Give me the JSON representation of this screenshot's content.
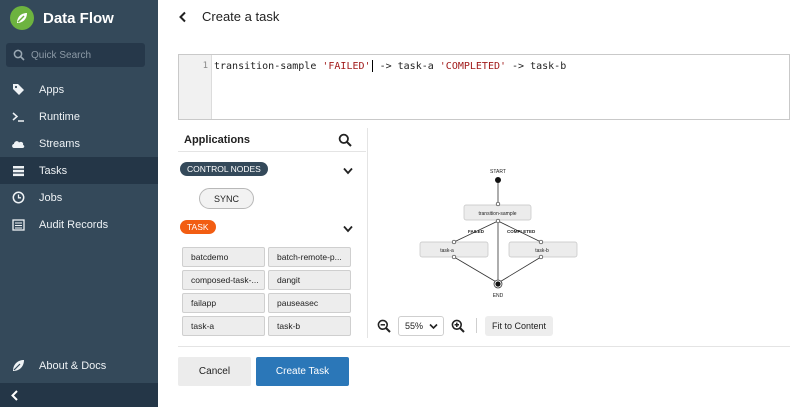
{
  "app": {
    "title": "Data Flow"
  },
  "sidebar": {
    "search_placeholder": "Quick Search",
    "items": [
      {
        "label": "Apps",
        "icon": "tag-icon"
      },
      {
        "label": "Runtime",
        "icon": "terminal-icon"
      },
      {
        "label": "Streams",
        "icon": "cloud-icon"
      },
      {
        "label": "Tasks",
        "icon": "server-icon",
        "active": true
      },
      {
        "label": "Jobs",
        "icon": "clock-icon"
      },
      {
        "label": "Audit Records",
        "icon": "list-icon"
      }
    ],
    "bottom": {
      "label": "About & Docs",
      "icon": "leaf-icon"
    }
  },
  "header": {
    "title": "Create a task"
  },
  "editor": {
    "line_number": "1",
    "code_part1": "transition-sample ",
    "code_str1": "'FAILED'",
    "code_part2": " -> task-a ",
    "code_str2": "'COMPLETED'",
    "code_part3": " -> task-b"
  },
  "applications": {
    "title": "Applications",
    "control_nodes": {
      "label": "CONTROL NODES",
      "items": [
        "SYNC"
      ]
    },
    "task": {
      "label": "TASK",
      "items": [
        "batcdemo",
        "batch-remote-p...",
        "composed-task-...",
        "dangit",
        "failapp",
        "pauseasec",
        "task-a",
        "task-b"
      ]
    }
  },
  "graph": {
    "start_label": "START",
    "end_label": "END",
    "main_node": "transition-sample",
    "left_node": "task-a",
    "right_node": "task-b",
    "failed_label": "FAILED",
    "completed_label": "COMPLETED"
  },
  "toolbar": {
    "zoom": "55%",
    "fit_label": "Fit to Content"
  },
  "footer": {
    "cancel_label": "Cancel",
    "create_label": "Create Task"
  },
  "colors": {
    "sidebar": "#34495a",
    "sidebar_active": "#243647",
    "primary": "#2b77b8",
    "task_badge": "#f25d12",
    "brand_logo": "#6db33f",
    "code_string": "#a11a1a"
  }
}
